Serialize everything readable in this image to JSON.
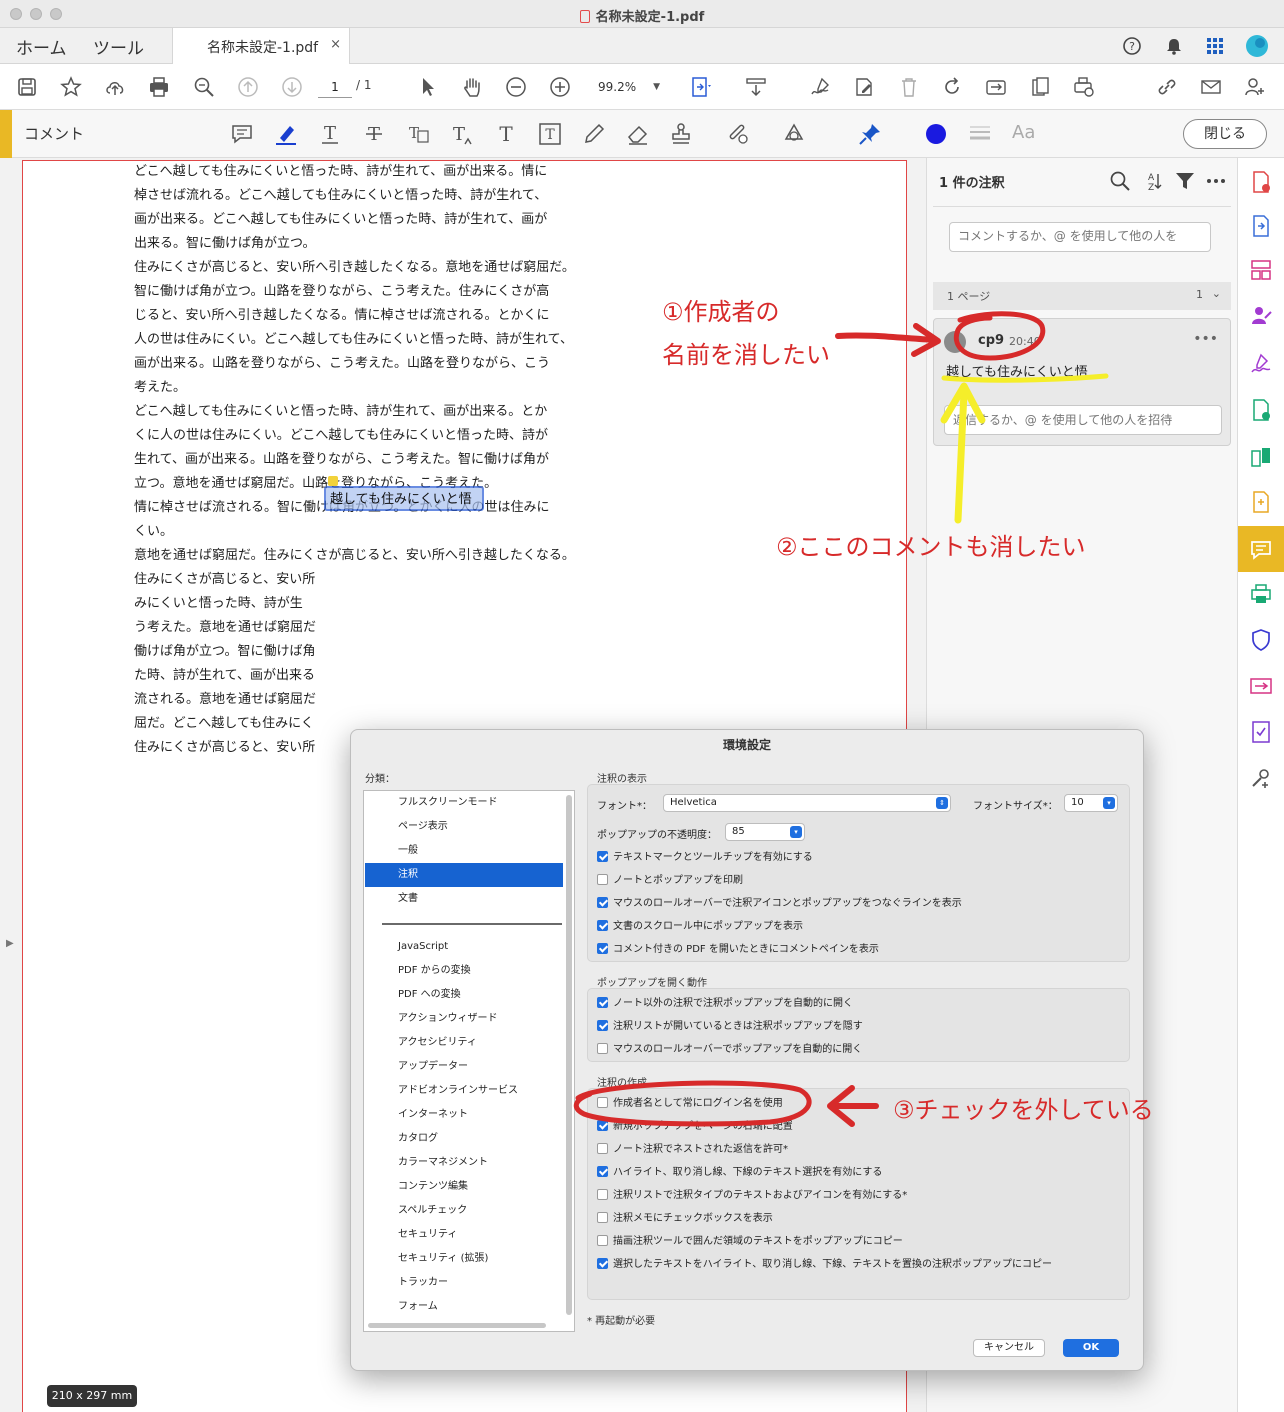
{
  "window": {
    "title": "名称未設定-1.pdf"
  },
  "tabs": {
    "home": "ホーム",
    "tools": "ツール",
    "document": "名称未設定-1.pdf",
    "close": "×"
  },
  "toolbar": {
    "page_current": "1",
    "page_total": "/ 1",
    "zoom": "99.2%"
  },
  "comment_toolbar": {
    "title": "コメント",
    "close_button": "閉じる",
    "font_icon_label": "Aa",
    "accent_color": "#e9b825",
    "color_swatch": "#1a1ae0"
  },
  "document": {
    "paragraphs": [
      "どこへ越しても住みにくいと悟った時、詩が生れて、画が出来る。情に\n棹させば流れる。どこへ越しても住みにくいと悟った時、詩が生れて、\n画が出来る。どこへ越しても住みにくいと悟った時、詩が生れて、画が\n出来る。智に働けば角が立つ。",
      "住みにくさが高じると、安い所へ引き越したくなる。意地を通せば窮屈だ。\n智に働けば角が立つ。山路を登りながら、こう考えた。住みにくさが高\nじると、安い所へ引き越したくなる。情に棹させば流される。とかくに\n人の世は住みにくい。どこへ越しても住みにくいと悟った時、詩が生れて、\n画が出来る。山路を登りながら、こう考えた。山路を登りながら、こう\n考えた。",
      "どこへ越しても住みにくいと悟った時、詩が生れて、画が出来る。とか\nくに人の世は住みにくい。どこへ越しても住みにくいと悟った時、詩が\n生れて、画が出来る。山路を登りながら、こう考えた。智に働けば角が\n立つ。意地を通せば窮屈だ。山路を登りながら、こう考えた。",
      "情に棹させば流される。智に働けば角が立つ。とかくに人の世は住みに\nくい。",
      "意地を通せば窮屈だ。住みにくさが高じると、安い所へ引き越したくなる。\n住みにくさが高じると、安い所\nみにくいと悟った時、詩が生\nう考えた。意地を通せば窮屈だ\n働けば角が立つ。智に働けば角\nた時、詩が生れて、画が出来る\n流される。意地を通せば窮屈だ\n屈だ。どこへ越しても住みにく\n住みにくさが高じると、安い所"
    ],
    "highlight": "越しても住みにくいと悟",
    "size_badge": "210 x 297 mm"
  },
  "comment_pane": {
    "title": "1 件の注釈",
    "input_placeholder": "コメントするか、@ を使用して他の人を",
    "page_group": "1 ページ",
    "page_count": "1",
    "comment": {
      "author": "cp9",
      "time": "20:40",
      "text": "越しても住みにくいと悟",
      "more": "•••"
    },
    "reply_placeholder": "返信するか、@ を使用して他の人を招待"
  },
  "dialog": {
    "title": "環境設定",
    "category_label": "分類：",
    "categories_top": [
      "フルスクリーンモード",
      "ページ表示",
      "一般",
      "注釈",
      "文書"
    ],
    "categories_bottom": [
      "JavaScript",
      "PDF からの変換",
      "PDF への変換",
      "アクションウィザード",
      "アクセシビリティ",
      "アップデーター",
      "アドビオンラインサービス",
      "インターネット",
      "カタログ",
      "カラーマネジメント",
      "コンテンツ編集",
      "スペルチェック",
      "セキュリティ",
      "セキュリティ (拡張)",
      "トラッカー",
      "フォーム"
    ],
    "selected_category": "注釈",
    "display": {
      "title": "注釈の表示",
      "font_label": "フォント*：",
      "font_value": "Helvetica",
      "size_label": "フォントサイズ*：",
      "size_value": "10",
      "opacity_label": "ポップアップの不透明度：",
      "opacity_value": "85",
      "checks": [
        {
          "label": "テキストマークとツールチップを有効にする",
          "on": true
        },
        {
          "label": "ノートとポップアップを印刷",
          "on": false
        },
        {
          "label": "マウスのロールオーバーで注釈アイコンとポップアップをつなぐラインを表示",
          "on": true
        },
        {
          "label": "文書のスクロール中にポップアップを表示",
          "on": true
        },
        {
          "label": "コメント付きの PDF を開いたときにコメントペインを表示",
          "on": true
        }
      ]
    },
    "popup": {
      "title": "ポップアップを開く動作",
      "checks": [
        {
          "label": "ノート以外の注釈で注釈ポップアップを自動的に開く",
          "on": true
        },
        {
          "label": "注釈リストが開いているときは注釈ポップアップを隠す",
          "on": true
        },
        {
          "label": "マウスのロールオーバーでポップアップを自動的に開く",
          "on": false
        }
      ]
    },
    "create": {
      "title": "注釈の作成",
      "checks": [
        {
          "label": "作成者名として常にログイン名を使用",
          "on": false
        },
        {
          "label": "新規ポップアップをページの右端に配置",
          "on": true
        },
        {
          "label": "ノート注釈でネストされた返信を許可*",
          "on": false
        },
        {
          "label": "ハイライト、取り消し線、下線のテキスト選択を有効にする",
          "on": true
        },
        {
          "label": "注釈リストで注釈タイプのテキストおよびアイコンを有効にする*",
          "on": false
        },
        {
          "label": "注釈メモにチェックボックスを表示",
          "on": false
        },
        {
          "label": "描画注釈ツールで囲んだ領域のテキストをポップアップにコピー",
          "on": false
        },
        {
          "label": "選択したテキストをハイライト、取り消し線、下線、テキストを置換の注釈ポップアップにコピー",
          "on": true
        }
      ]
    },
    "restart_note": "* 再起動が必要",
    "cancel": "キャンセル",
    "ok": "OK"
  },
  "annotations": {
    "note1_line1": "①作成者の",
    "note1_line2": "名前を消したい",
    "note2": "②ここのコメントも消したい",
    "note3": "③チェックを外している",
    "red": "#d72a2a",
    "yellow": "#f5ee2a"
  }
}
